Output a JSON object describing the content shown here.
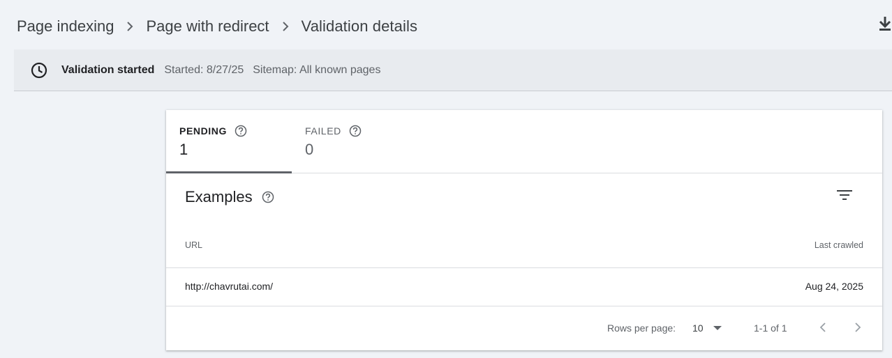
{
  "breadcrumb": {
    "items": [
      "Page indexing",
      "Page with redirect",
      "Validation details"
    ]
  },
  "toolbar": {
    "download_icon": "download-icon"
  },
  "validation": {
    "status": "Validation started",
    "started": "Started: 8/27/25",
    "sitemap": "Sitemap: All known pages",
    "icon": "clock-icon"
  },
  "tabs": [
    {
      "label": "PENDING",
      "count": "1",
      "selected": true
    },
    {
      "label": "FAILED",
      "count": "0",
      "selected": false
    }
  ],
  "examples": {
    "title": "Examples",
    "table": {
      "columns": [
        "URL",
        "Last crawled"
      ],
      "rows": [
        {
          "url": "http://chavrutai.com/",
          "last_crawled": "Aug 24, 2025"
        }
      ]
    },
    "pagination": {
      "rows_per_page_label": "Rows per page:",
      "rows_per_page_value": "10",
      "range": "1-1 of 1"
    }
  },
  "colors": {
    "background": "#f0f3f7",
    "card": "#ffffff",
    "bar": "#e8ebef",
    "text_primary": "#202124",
    "text_secondary": "#5f6368"
  }
}
